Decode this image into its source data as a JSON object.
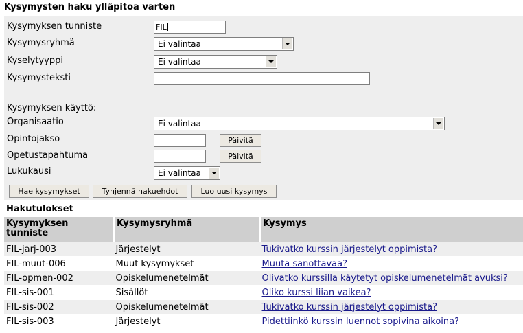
{
  "form": {
    "title": "Kysymysten haku ylläpitoa varten",
    "fields": {
      "tunniste_label": "Kysymyksen tunniste",
      "tunniste_value": "FIL",
      "ryhma_label": "Kysymysryhmä",
      "ryhma_value": "Ei valintaa",
      "tyyppi_label": "Kyselytyyppi",
      "tyyppi_value": "Ei valintaa",
      "teksti_label": "Kysymysteksti",
      "teksti_value": ""
    },
    "usage": {
      "heading": "Kysymyksen käyttö:",
      "organisaatio_label": "Organisaatio",
      "organisaatio_value": "Ei valintaa",
      "opintojakso_label": "Opintojakso",
      "opintojakso_value": "",
      "opetustapahtuma_label": "Opetustapahtuma",
      "opetustapahtuma_value": "",
      "update_label": "Päivitä",
      "lukukausi_label": "Lukukausi",
      "lukukausi_value": "Ei valintaa"
    },
    "buttons": {
      "search": "Hae kysymykset",
      "clear": "Tyhjennä hakuehdot",
      "new": "Luo uusi kysymys"
    }
  },
  "results": {
    "heading": "Hakutulokset",
    "columns": [
      "Kysymyksen tunniste",
      "Kysymysryhmä",
      "Kysymys"
    ],
    "rows": [
      {
        "id": "FIL-jarj-003",
        "group": "Järjestelyt",
        "question": "Tukivatko kurssin järjestelyt oppimista?"
      },
      {
        "id": "FIL-muut-006",
        "group": "Muut kysymykset",
        "question": "Muuta sanottavaa?"
      },
      {
        "id": "FIL-opmen-002",
        "group": "Opiskelumenetelmät",
        "question": "Olivatko kurssilla käytetyt opiskelumenetelmät avuksi?"
      },
      {
        "id": "FIL-sis-001",
        "group": "Sisällöt",
        "question": "Oliko kurssi liian vaikea?"
      },
      {
        "id": "FIL-sis-002",
        "group": "Opiskelumenetelmät",
        "question": "Tukivatko kurssin järjestelyt oppimista?"
      },
      {
        "id": "FIL-sis-003",
        "group": "Järjestelyt",
        "question": "Pidettiinkö kurssin luennot sopivina aikoina?"
      }
    ]
  }
}
